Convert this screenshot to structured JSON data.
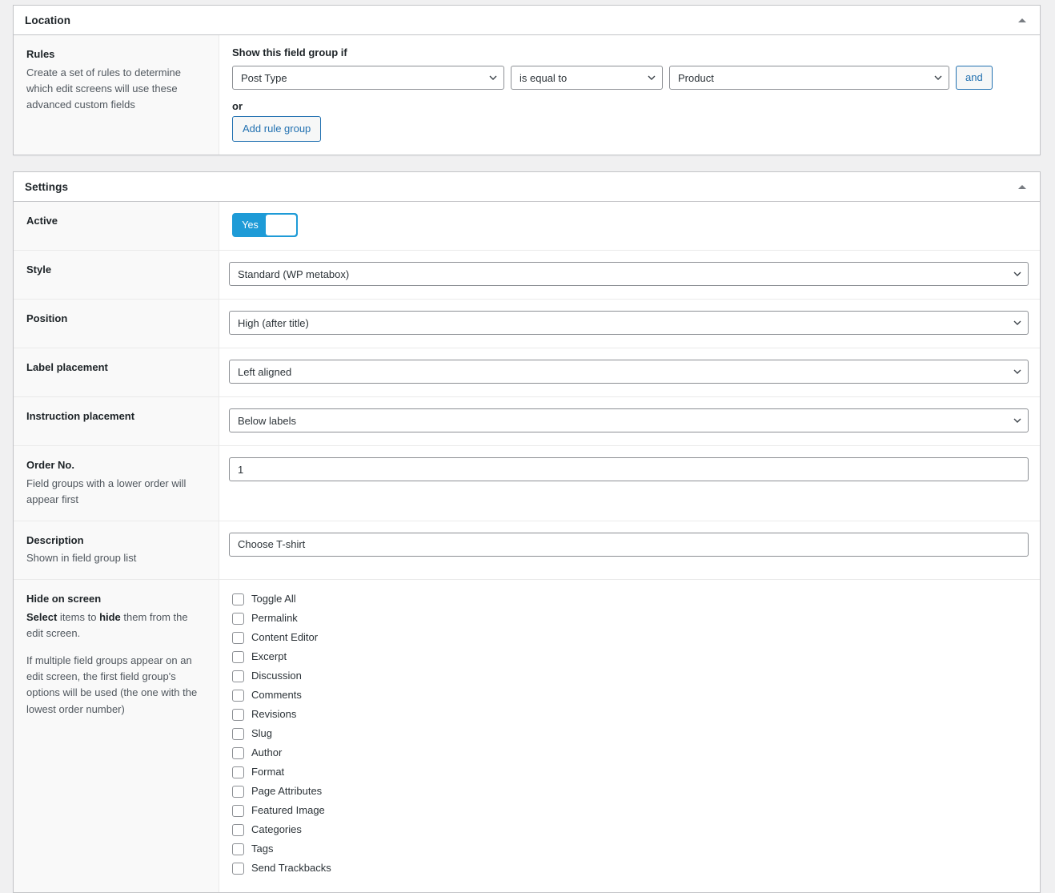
{
  "location_panel": {
    "title": "Location",
    "collapse_icon": "triangle-up-icon",
    "rules": {
      "label": "Rules",
      "description": "Create a set of rules to determine which edit screens will use these advanced custom fields",
      "intro": "Show this field group if",
      "param_value": "Post Type",
      "operator_value": "is equal to",
      "value_value": "Product",
      "and_button": "and",
      "or_label": "or",
      "add_rule_group_button": "Add rule group"
    }
  },
  "settings_panel": {
    "title": "Settings",
    "collapse_icon": "triangle-up-icon",
    "rows": {
      "active": {
        "label": "Active",
        "toggle_on_text": "Yes",
        "toggle_state": "on"
      },
      "style": {
        "label": "Style",
        "value": "Standard (WP metabox)"
      },
      "position": {
        "label": "Position",
        "value": "High (after title)"
      },
      "label_placement": {
        "label": "Label placement",
        "value": "Left aligned"
      },
      "instruction_placement": {
        "label": "Instruction placement",
        "value": "Below labels"
      },
      "order_no": {
        "label": "Order No.",
        "description": "Field groups with a lower order will appear first",
        "value": "1"
      },
      "description": {
        "label": "Description",
        "description": "Shown in field group list",
        "value": "Choose T-shirt"
      },
      "hide_on_screen": {
        "label": "Hide on screen",
        "description_part1_bold1": "Select",
        "description_part1_mid": " items to ",
        "description_part1_bold2": "hide",
        "description_part1_end": " them from the edit screen.",
        "description_part2": "If multiple field groups appear on an edit screen, the first field group's options will be used (the one with the lowest order number)",
        "items": [
          {
            "label": "Toggle All",
            "checked": false
          },
          {
            "label": "Permalink",
            "checked": false
          },
          {
            "label": "Content Editor",
            "checked": false
          },
          {
            "label": "Excerpt",
            "checked": false
          },
          {
            "label": "Discussion",
            "checked": false
          },
          {
            "label": "Comments",
            "checked": false
          },
          {
            "label": "Revisions",
            "checked": false
          },
          {
            "label": "Slug",
            "checked": false
          },
          {
            "label": "Author",
            "checked": false
          },
          {
            "label": "Format",
            "checked": false
          },
          {
            "label": "Page Attributes",
            "checked": false
          },
          {
            "label": "Featured Image",
            "checked": false
          },
          {
            "label": "Categories",
            "checked": false
          },
          {
            "label": "Tags",
            "checked": false
          },
          {
            "label": "Send Trackbacks",
            "checked": false
          }
        ]
      }
    }
  },
  "colors": {
    "accent_blue": "#2271b1",
    "toggle_blue": "#1e9bd7",
    "panel_border": "#c3c4c7",
    "label_bg": "#f9f9f9",
    "page_bg": "#f0f0f1"
  }
}
